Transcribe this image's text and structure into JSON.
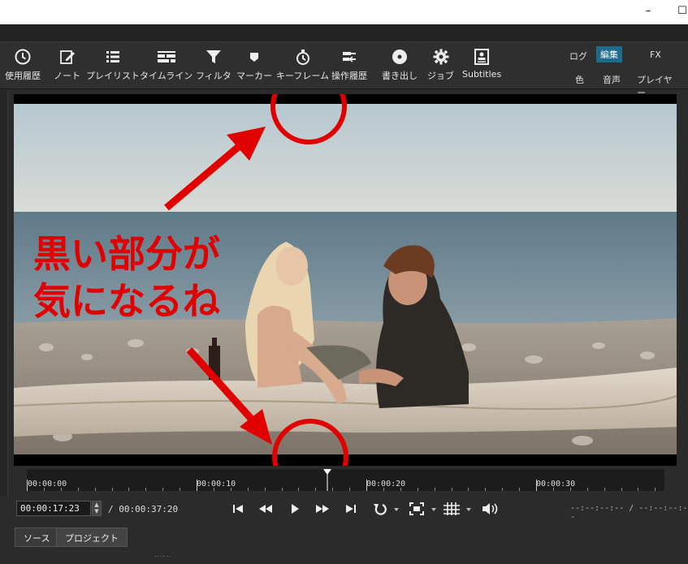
{
  "window": {
    "minimize": "–",
    "maximize": "☐"
  },
  "toolbar": {
    "items": [
      {
        "label": "使用履歴",
        "icon": "clock-icon"
      },
      {
        "label": "ノート",
        "icon": "note-edit-icon"
      },
      {
        "label": "プレイリスト",
        "icon": "list-icon"
      },
      {
        "label": "タイムライン",
        "icon": "timeline-icon"
      },
      {
        "label": "フィルタ",
        "icon": "filter-funnel-icon"
      },
      {
        "label": "マーカー",
        "icon": "marker-icon"
      },
      {
        "label": "キーフレーム",
        "icon": "stopwatch-icon"
      },
      {
        "label": "操作履歴",
        "icon": "history-icon"
      },
      {
        "label": "書き出し",
        "icon": "disc-export-icon"
      },
      {
        "label": "ジョブ",
        "icon": "gear-icon"
      },
      {
        "label": "Subtitles",
        "icon": "subtitles-icon"
      }
    ]
  },
  "layouts": {
    "row1": [
      "ログ",
      "編集",
      "FX"
    ],
    "row2": [
      "色",
      "音声",
      "プレイヤー"
    ],
    "active": "編集",
    "active_color": "#1e6b8c"
  },
  "annotation": {
    "line1": "黒い部分が",
    "line2": "気になるね",
    "color": "#e00000"
  },
  "timeline": {
    "ticks": [
      "00:00:00",
      "00:00:10",
      "00:00:20",
      "00:00:30"
    ],
    "playhead_seconds": 17.7
  },
  "transport": {
    "timecode": "00:00:17:23",
    "total": "/ 00:00:37:20",
    "in_out": "--:--:--:-- / --:--:--:--"
  },
  "bottom_tabs": [
    "ソース",
    "プロジェクト"
  ],
  "grip": "......"
}
